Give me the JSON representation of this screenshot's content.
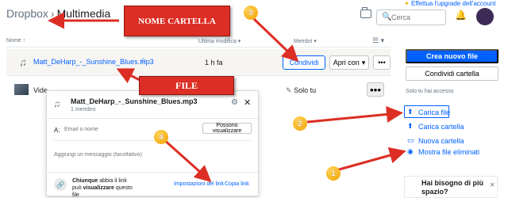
{
  "header": {
    "breadcrumb_root": "Dropbox",
    "breadcrumb_sep": "›",
    "breadcrumb_current": "Multimedia",
    "upgrade_icon": "✦",
    "upgrade_text": "Effettua l'upgrade dell'account",
    "search_placeholder": "Cerca",
    "search_icon": "🔍",
    "bell_icon": "🔔"
  },
  "table": {
    "col_name": "Nome ↑",
    "col_modified": "Ultima modifica ▾",
    "col_members": "Membri ▾",
    "view_icon": "☰ ▾"
  },
  "rows": [
    {
      "icon": "♫",
      "name": "Matt_DeHarp_-_Sunshine_Blues.mp3",
      "star": "☆",
      "modified": "1 h fa",
      "share_label": "Condividi",
      "open_label": "Apri con",
      "open_caret": "▾",
      "more_label": "•••"
    },
    {
      "name": "Vide",
      "member": "Solo tu",
      "pen_icon": "✎",
      "more_label": "•••"
    }
  ],
  "sidebar": {
    "primary_button": "Crea nuovo file",
    "secondary_button": "Condividi cartella",
    "access_label": "Solo tu hai accesso",
    "items": [
      {
        "icon": "⬆",
        "label": "Carica file"
      },
      {
        "icon": "⬆",
        "label": "Carica cartella"
      },
      {
        "icon": "▭",
        "label": "Nuova cartella"
      },
      {
        "icon": "◉",
        "label": "Mostra file eliminati"
      }
    ],
    "help_text": "Hai bisogno di più spazio?",
    "help_close": "✕"
  },
  "modal": {
    "icon": "♫",
    "title": "Matt_DeHarp_-_Sunshine_Blues.mp3",
    "subtitle": "1 membro",
    "gear_icon": "⚙",
    "close_icon": "✕",
    "to_label": "A:",
    "email_placeholder": "Email o nome",
    "permission_button": "Possono visualizzare",
    "message_placeholder": "Aggiungi un messaggio (facoltativo)",
    "link_icon": "🔗",
    "link_text_bold1": "Chiunque",
    "link_text_mid": " abbia il link può ",
    "link_text_bold2": "visualizzare",
    "link_text_end": " questo file",
    "link_settings": "Impostazioni del link",
    "link_dot": "·",
    "copy_link": "Copia link"
  },
  "annotations": {
    "callout_folder": "NOME CARTELLA",
    "callout_file": "FILE",
    "badges": [
      "1",
      "2",
      "3",
      "4"
    ],
    "callout_color": "#dc2e24",
    "badge_color": "#f2a300"
  }
}
